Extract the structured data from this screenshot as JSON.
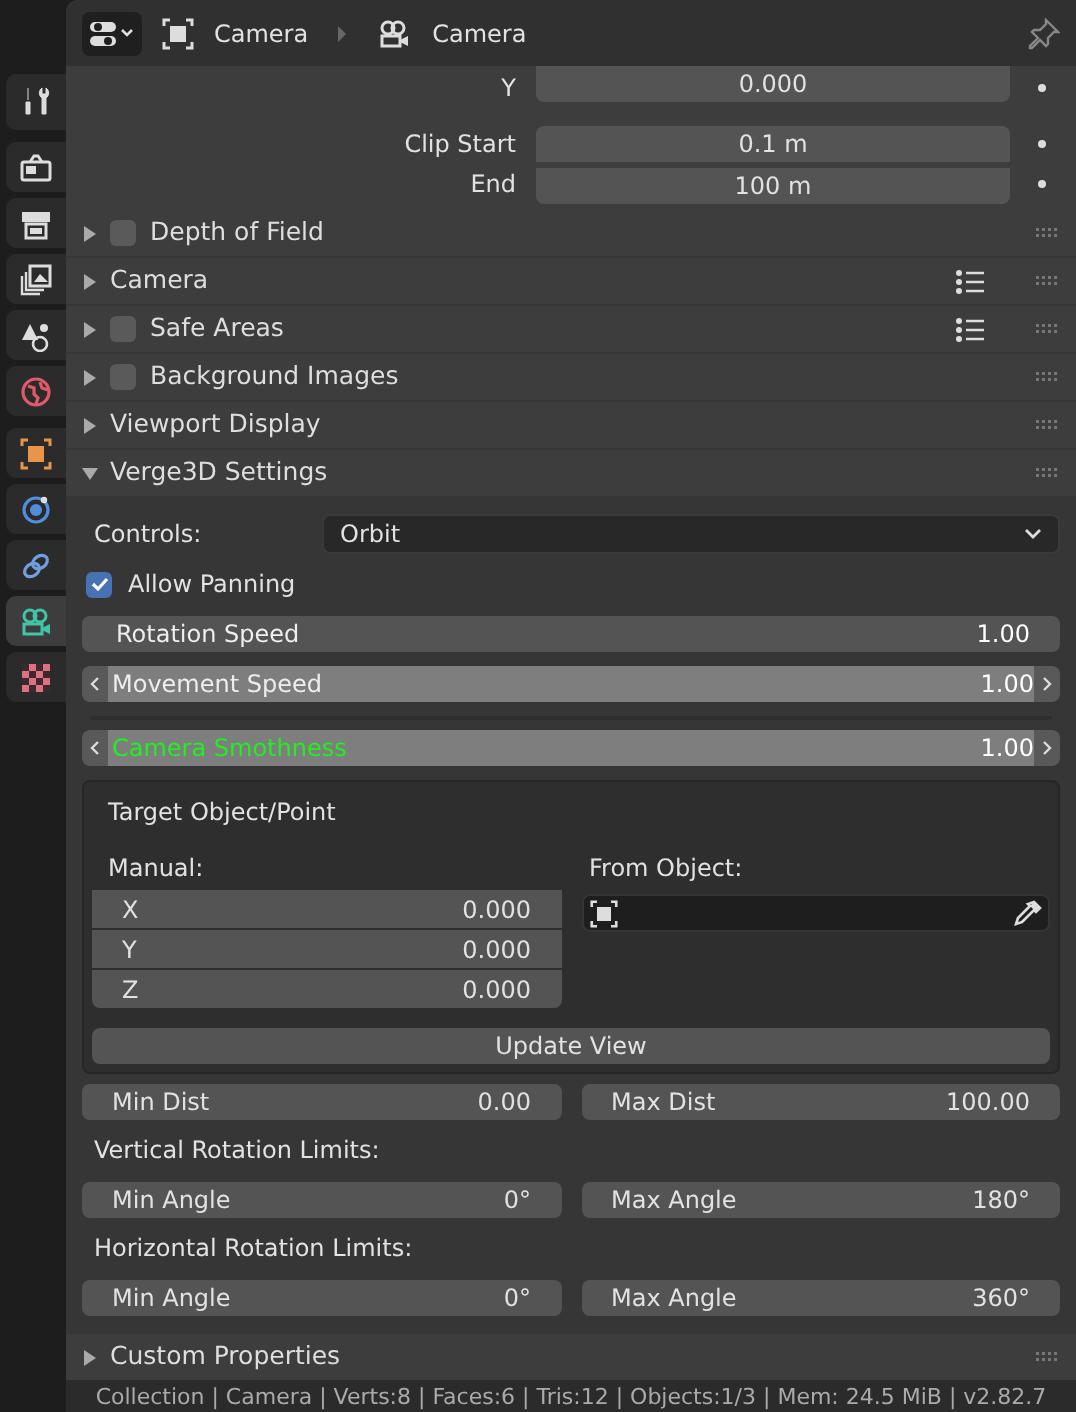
{
  "header": {
    "breadcrumbs": [
      {
        "kind": "object",
        "label": "Camera"
      },
      {
        "kind": "camera",
        "label": "Camera"
      }
    ]
  },
  "sidebar": {
    "tabs": [
      {
        "kind": "tool",
        "selected": false
      },
      {
        "kind": "render",
        "selected": false
      },
      {
        "kind": "output",
        "selected": false
      },
      {
        "kind": "view_layer",
        "selected": false
      },
      {
        "kind": "scene",
        "selected": false
      },
      {
        "kind": "world",
        "selected": false
      },
      {
        "kind": "object",
        "selected": false
      },
      {
        "kind": "physics",
        "selected": false
      },
      {
        "kind": "constraint",
        "selected": false
      },
      {
        "kind": "camera_data",
        "selected": true
      },
      {
        "kind": "texture",
        "selected": false
      }
    ]
  },
  "properties": [
    {
      "label": "Y",
      "value": "0.000"
    },
    {
      "label": "Clip Start",
      "value": "0.1 m"
    },
    {
      "label": "End",
      "value": "100 m"
    }
  ],
  "panels": [
    {
      "label": "Depth of Field",
      "kind": "checkbox",
      "checked": false,
      "expanded": false,
      "presets": false
    },
    {
      "label": "Camera",
      "kind": "plain",
      "expanded": false,
      "presets": true
    },
    {
      "label": "Safe Areas",
      "kind": "checkbox",
      "checked": false,
      "expanded": false,
      "presets": true
    },
    {
      "label": "Background Images",
      "kind": "checkbox",
      "checked": false,
      "expanded": false,
      "presets": false
    },
    {
      "label": "Viewport Display",
      "kind": "plain",
      "expanded": false,
      "presets": false
    },
    {
      "label": "Verge3D Settings",
      "kind": "plain",
      "expanded": true,
      "presets": false
    }
  ],
  "verge3d": {
    "controls": {
      "label": "Controls:",
      "value": "Orbit"
    },
    "allow_panning": {
      "label": "Allow Panning",
      "checked": true
    },
    "sliders": [
      {
        "kind": "plain",
        "label": "Rotation Speed",
        "value": "1.00",
        "highlighted": false
      },
      {
        "kind": "stepper",
        "label": "Movement Speed",
        "value": "1.00",
        "highlighted": false
      },
      {
        "kind": "stepper",
        "label": "Camera Smothness",
        "value": "1.00",
        "highlighted": true
      }
    ],
    "target": {
      "title": "Target Object/Point",
      "manual_label": "Manual:",
      "manual": [
        {
          "label": "X",
          "value": "0.000"
        },
        {
          "label": "Y",
          "value": "0.000"
        },
        {
          "label": "Z",
          "value": "0.000"
        }
      ],
      "from_object_label": "From Object:",
      "update_button": "Update View"
    },
    "distance": [
      {
        "label": "Min Dist",
        "value": "0.00"
      },
      {
        "label": "Max Dist",
        "value": "100.00"
      }
    ],
    "vertical_label": "Vertical Rotation Limits:",
    "vertical": [
      {
        "label": "Min Angle",
        "value": "0°"
      },
      {
        "label": "Max Angle",
        "value": "180°"
      }
    ],
    "horizontal_label": "Horizontal Rotation Limits:",
    "horizontal": [
      {
        "label": "Min Angle",
        "value": "0°"
      },
      {
        "label": "Max Angle",
        "value": "360°"
      }
    ]
  },
  "bottom_panels": [
    {
      "label": "Custom Properties",
      "expanded": false
    }
  ],
  "status_bar": "Collection | Camera | Verts:8 | Faces:6 | Tris:12 | Objects:1/3 | Mem: 24.5 MiB | v2.82.7"
}
